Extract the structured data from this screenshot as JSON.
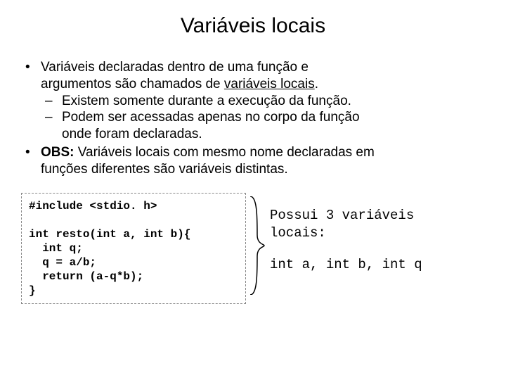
{
  "title": "Variáveis locais",
  "bullet1": {
    "line1": "Variáveis declaradas dentro de uma função e",
    "line2_pre": "argumentos são chamados de ",
    "line2_under": "variáveis locais",
    "line2_post": ".",
    "sub1": "Existem somente durante a execução da função.",
    "sub2a": "Podem ser acessadas apenas no corpo da função",
    "sub2b": "onde foram declaradas."
  },
  "bullet2": {
    "label": "OBS:",
    "line1": " Variáveis locais com mesmo nome declaradas em",
    "line2": "funções diferentes são variáveis distintas."
  },
  "code": "#include <stdio. h>\n\nint resto(int a, int b){\n  int q;\n  q = a/b;\n  return (a-q*b);\n}",
  "side": {
    "l1": "Possui 3 variáveis",
    "l2": "locais:",
    "l3": "int a, int b, int q"
  }
}
